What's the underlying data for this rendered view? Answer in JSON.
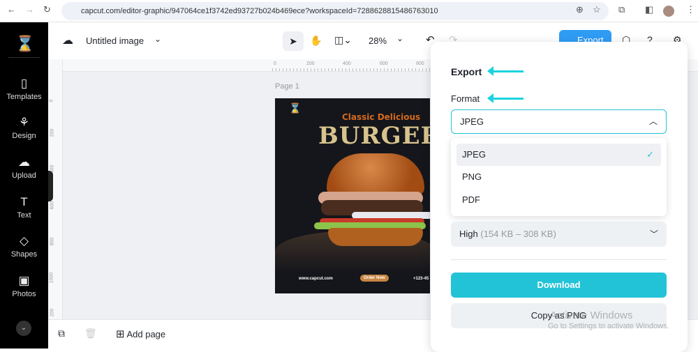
{
  "browser": {
    "url": "capcut.com/editor-graphic/947064ce1f3742ed93727b024b469ece?workspaceId=7288628815486763010"
  },
  "sidebar": {
    "items": [
      {
        "label": "Templates",
        "icon": "templates-icon"
      },
      {
        "label": "Design",
        "icon": "design-icon"
      },
      {
        "label": "Upload",
        "icon": "upload-icon"
      },
      {
        "label": "Text",
        "icon": "text-icon"
      },
      {
        "label": "Shapes",
        "icon": "shapes-icon"
      },
      {
        "label": "Photos",
        "icon": "photos-icon"
      }
    ]
  },
  "topbar": {
    "title": "Untitled image",
    "zoom": "28%",
    "export_label": "Export"
  },
  "ruler": {
    "h": [
      "0",
      "200",
      "400",
      "600",
      "800"
    ],
    "v": [
      "0",
      "200",
      "400",
      "600",
      "800",
      "1000",
      "200"
    ]
  },
  "canvas": {
    "page_label": "Page 1",
    "design": {
      "subtitle": "Classic Delicious",
      "headline": "BURGER",
      "website": "www.capcut.com",
      "cta": "Order Now",
      "phone": "+123-45"
    }
  },
  "bottombar": {
    "add_page": "Add page"
  },
  "export": {
    "title": "Export",
    "format_label": "Format",
    "format_value": "JPEG",
    "options": [
      "JPEG",
      "PNG",
      "PDF"
    ],
    "quality": "High",
    "quality_size": "(154 KB – 308 KB)",
    "download": "Download",
    "copy": "Copy as PNG"
  },
  "watermark": {
    "line1": "Activate Windows",
    "line2": "Go to Settings to activate Windows."
  },
  "colors": {
    "accent": "#22c3d6",
    "arrow": "#1ad3e0"
  }
}
